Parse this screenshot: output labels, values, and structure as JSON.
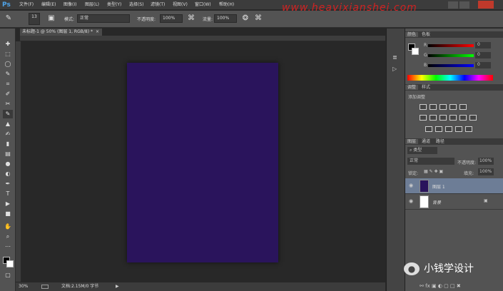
{
  "app": {
    "logo": "Ps"
  },
  "menu": [
    "文件(F)",
    "编辑(E)",
    "图像(I)",
    "图层(L)",
    "类型(Y)",
    "选择(S)",
    "滤镜(T)",
    "视图(V)",
    "窗口(W)",
    "帮助(H)"
  ],
  "watermark": "www.heavixianshei.com",
  "options": {
    "brush_size": "13",
    "mode_label": "模式:",
    "mode_value": "正常",
    "opacity_label": "不透明度:",
    "opacity_value": "100%",
    "flow_label": "流量:",
    "flow_value": "100%"
  },
  "document": {
    "tab_title": "未标题-1 @ 50% (图层 1, RGB/8) *",
    "fill_color": "#2a145c"
  },
  "status": {
    "zoom": "30%",
    "doc_info": "文档:2.15M/0 字节"
  },
  "color_panel": {
    "tabs": [
      "颜色",
      "色板"
    ],
    "r_label": "R",
    "g_label": "G",
    "b_label": "B",
    "r_value": "0",
    "g_value": "0",
    "b_value": "0"
  },
  "adjust_panel": {
    "tabs": [
      "调整",
      "样式"
    ],
    "title": "添加调整"
  },
  "layers_panel": {
    "tabs": [
      "图层",
      "通道",
      "路径"
    ],
    "kind": "类型",
    "blend": "正常",
    "opacity_label": "不透明度:",
    "opacity_value": "100%",
    "lock_label": "锁定:",
    "fill_label": "填充:",
    "fill_value": "100%",
    "layers": [
      {
        "name": "图层 1",
        "selected": true
      },
      {
        "name": "背景",
        "selected": false
      }
    ]
  },
  "branding": {
    "text": "小钱学设计"
  }
}
